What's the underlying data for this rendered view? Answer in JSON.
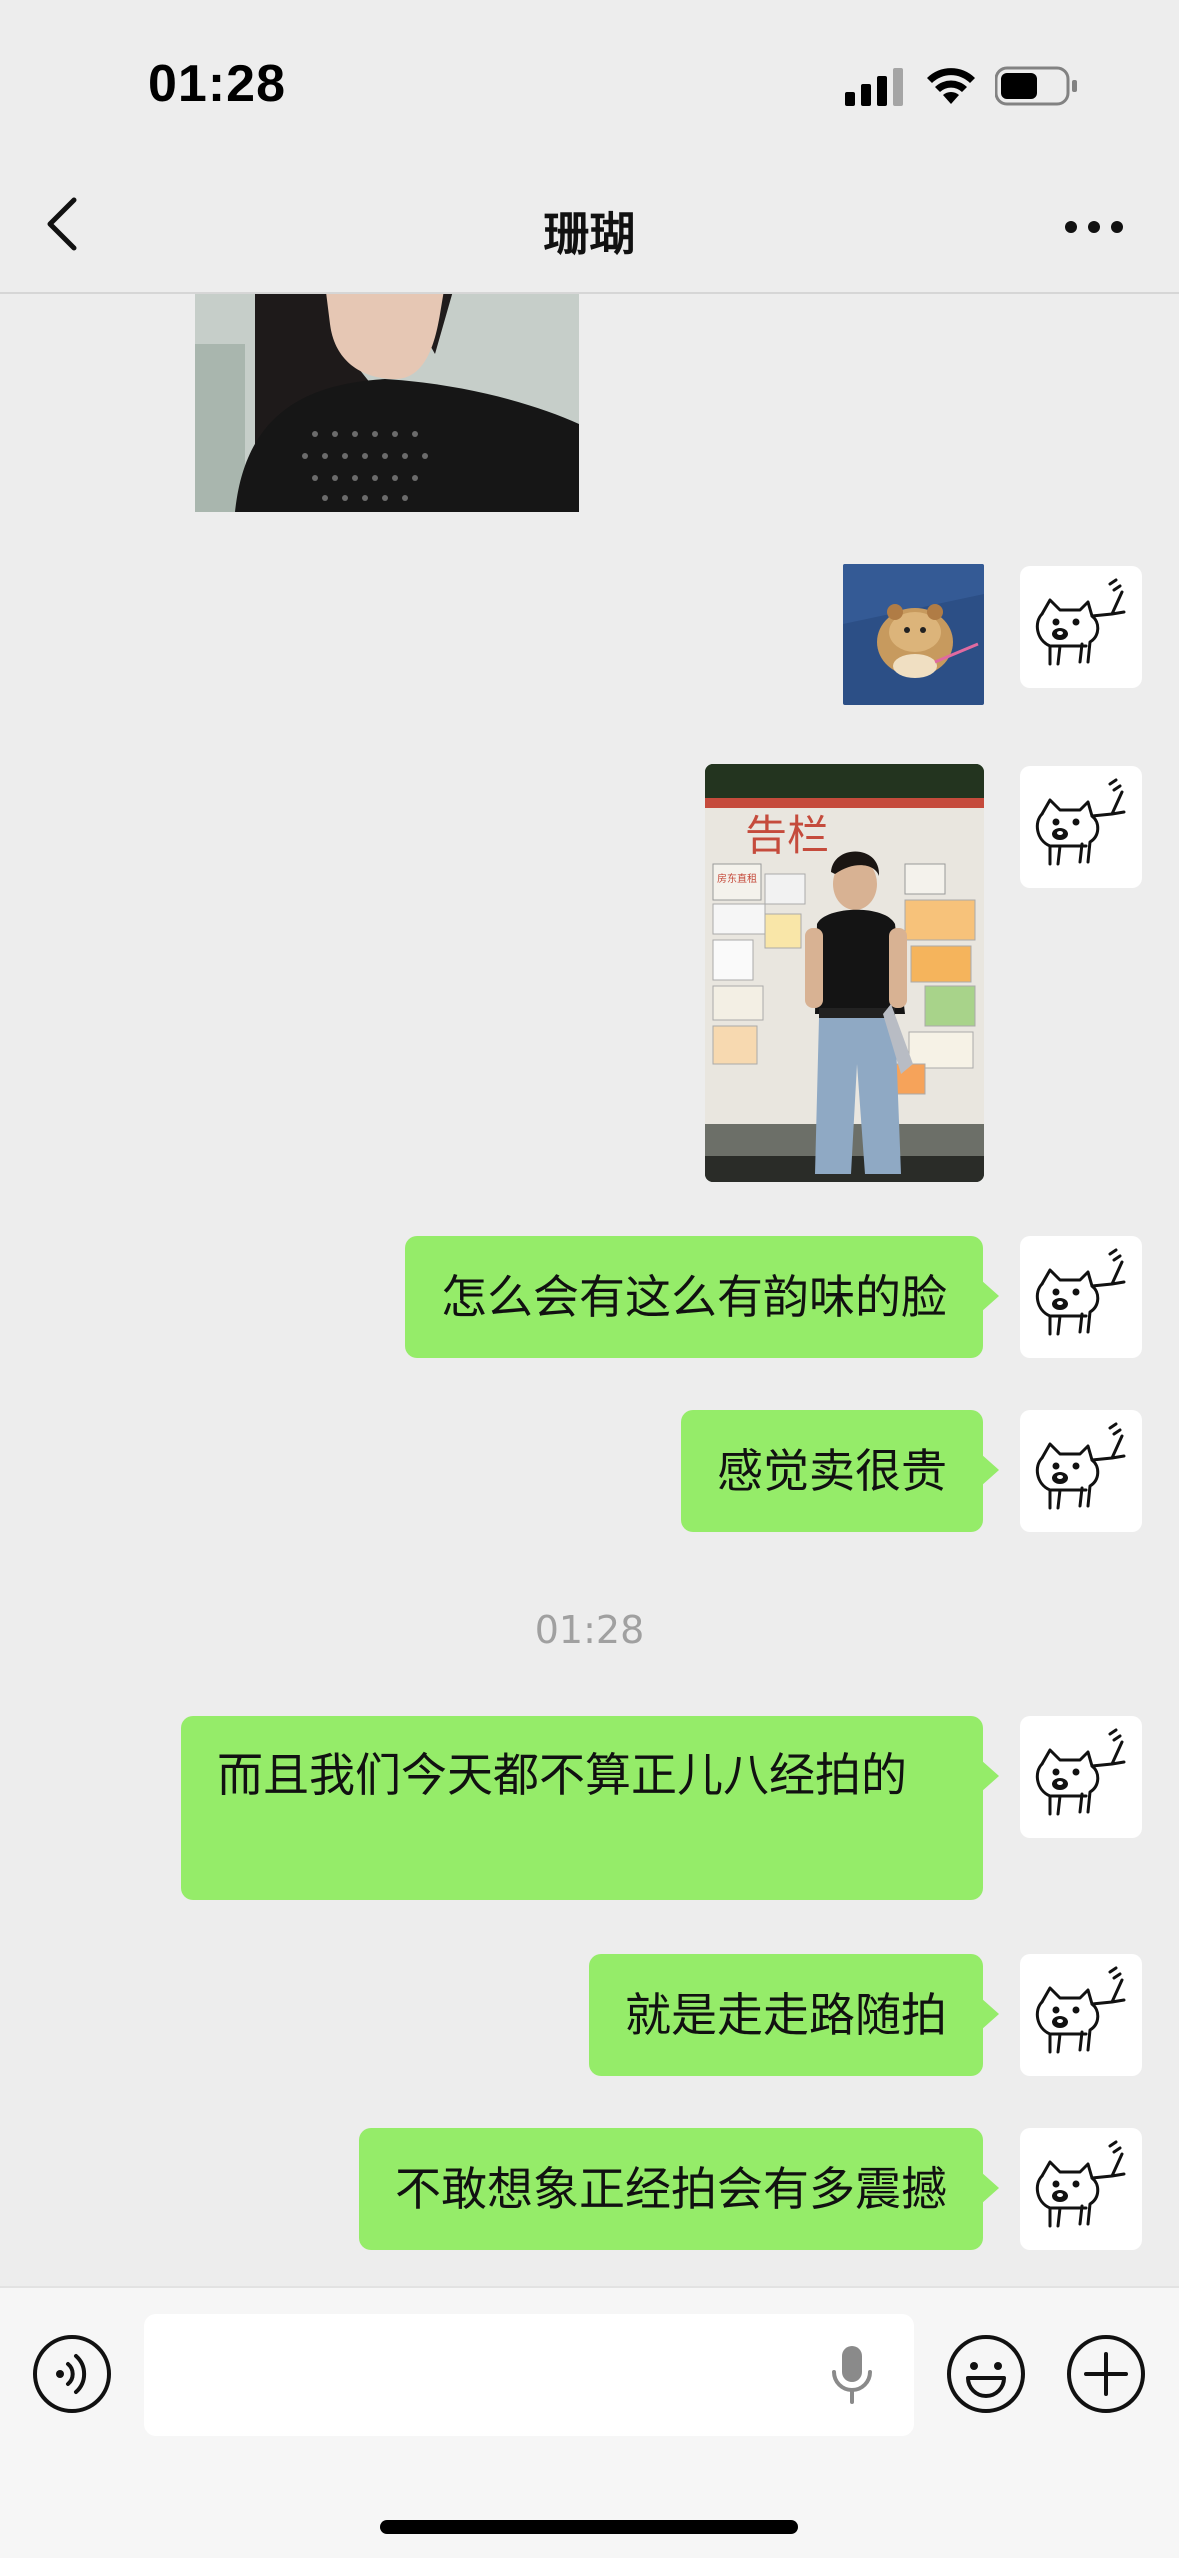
{
  "status_bar": {
    "time": "01:28",
    "icons": [
      "signal-icon",
      "wifi-icon",
      "battery-icon"
    ]
  },
  "nav": {
    "title": "珊瑚",
    "icons": [
      "back-icon",
      "more-icon"
    ]
  },
  "chat": {
    "messages": [
      {
        "type": "image",
        "side": "received",
        "content": "photo-person-dark-top"
      },
      {
        "type": "image",
        "side": "sent",
        "content": "photo-hamster"
      },
      {
        "type": "image",
        "side": "sent",
        "content": "photo-man-bulletin-board"
      },
      {
        "type": "text",
        "side": "sent",
        "text": "怎么会有这么有韵味的脸"
      },
      {
        "type": "text",
        "side": "sent",
        "text": "感觉卖很贵"
      },
      {
        "type": "timestamp",
        "text": "01:28"
      },
      {
        "type": "text",
        "side": "sent",
        "text": "而且我们今天都不算正儿八经拍的"
      },
      {
        "type": "text",
        "side": "sent",
        "text": "就是走走路随拍"
      },
      {
        "type": "text",
        "side": "sent",
        "text": "不敢想象正经拍会有多震撼"
      }
    ],
    "avatar_icon": "cat-doodle-avatar",
    "poster_sign_text": "告栏",
    "poster_notice_text": "房东直租"
  },
  "input_bar": {
    "value": "",
    "icons": [
      "voice-icon",
      "mic-icon",
      "emoji-icon",
      "plus-icon"
    ]
  },
  "colors": {
    "background": "#ededed",
    "bubble_sent": "#95ec69",
    "timestamp": "#a0a0a0"
  }
}
